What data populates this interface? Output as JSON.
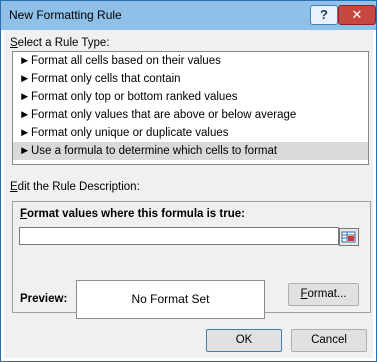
{
  "window": {
    "title": "New Formatting Rule",
    "help_label": "?",
    "close_label": "✕"
  },
  "rule_type": {
    "label_prefix": "S",
    "label_rest": "elect a Rule Type:",
    "items": [
      "Format all cells based on their values",
      "Format only cells that contain",
      "Format only top or bottom ranked values",
      "Format only values that are above or below average",
      "Format only unique or duplicate values",
      "Use a formula to determine which cells to format"
    ],
    "selected_index": 5,
    "arrow_glyph": "►"
  },
  "description": {
    "label_prefix": "E",
    "label_rest": "dit the Rule Description:",
    "formula_label_prefix": "F",
    "formula_label_rest": "ormat values where this formula is true:",
    "formula_value": "",
    "preview_label": "Preview:",
    "preview_text": "No Format Set",
    "format_button_prefix": "F",
    "format_button_rest": "ormat..."
  },
  "buttons": {
    "ok": "OK",
    "cancel": "Cancel"
  }
}
